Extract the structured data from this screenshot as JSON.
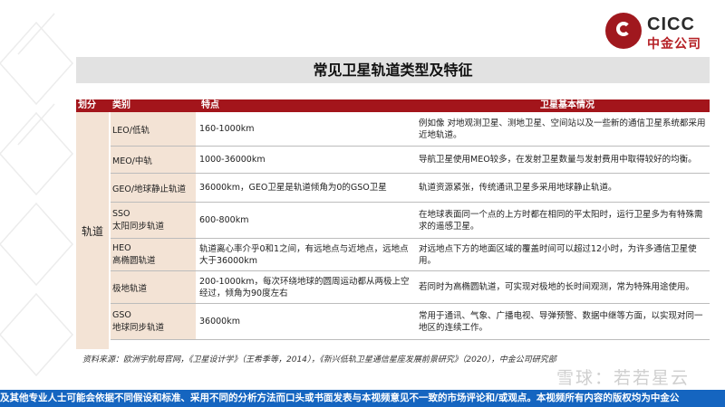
{
  "logo": {
    "en": "CICC",
    "cn": "中金公司"
  },
  "title": "常见卫星轨道类型及特征",
  "table": {
    "headers": {
      "division": "划分",
      "category": "类别",
      "features": "特点",
      "info": "卫星基本情况"
    },
    "group_label": "轨道",
    "rows": [
      {
        "category": [
          "LEO/低轨"
        ],
        "features": "160-1000km",
        "info": "例如像 对地观测卫星、测地卫星、空间站以及一些新的通信卫星系统都采用近地轨道。"
      },
      {
        "category": [
          "MEO/中轨"
        ],
        "features": "1000-36000km",
        "info": "导航卫星使用MEO较多，在发射卫星数量与发射费用中取得较好的均衡。"
      },
      {
        "category": [
          "GEO/地球静止轨道"
        ],
        "features": "36000km，GEO卫星是轨道倾角为0的GSO卫星",
        "info": "轨道资源紧张，传统通讯卫星多采用地球静止轨道。"
      },
      {
        "category": [
          "SSO",
          "太阳同步轨道"
        ],
        "features": "600-800km",
        "info": "在地球表面同一个点的上方时都在相同的平太阳时，运行卫星多为有特殊需求的遥感卫星。"
      },
      {
        "category": [
          "HEO",
          "高椭圆轨道"
        ],
        "features": "轨道离心率介乎0和1之间，有远地点与近地点，远地点大于36000km",
        "info": "对远地点下方的地面区域的覆盖时间可以超过12小时，为许多通信卫星使用。"
      },
      {
        "category": [
          "极地轨道"
        ],
        "features": "200-1000km，每次环绕地球的圆周运动都从两极上空经过，倾角为90度左右",
        "info": "若同时为高椭圆轨道，可实现对极地的长时间观测，常为特殊用途使用。"
      },
      {
        "category": [
          "GSO",
          "地球同步轨道"
        ],
        "features": "36000km",
        "info": "常用于通讯、气象、广播电视、导弹预警、数据中继等方面，以实现对同一地区的连续工作。"
      }
    ]
  },
  "source": "资料来源：欧洲宇航局官网，《卫星设计学》（王希季等，2014），《新兴低轨卫星通信星座发展前景研究》（2020），中金公司研究部",
  "watermark": "雪球：若若星云",
  "ticker": "及其他专业人士可能会依据不同假设和标准、采用不同的分析方法而口头或书面发表与本视频意见不一致的市场评论和/或观点。本视频所有内容的版权均为中金公"
}
